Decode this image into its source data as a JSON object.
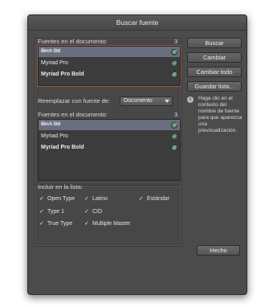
{
  "window": {
    "title": "Buscar fuente"
  },
  "doc_fonts": {
    "label": "Fuentes en el documento:",
    "count": "3",
    "items": [
      "Birch Std",
      "Myriad Pro",
      "Myriad Pro Bold"
    ]
  },
  "replace": {
    "label": "Reemplazar con fuente de:",
    "source": "Documento"
  },
  "replace_fonts": {
    "label": "Fuentes en el documento:",
    "count": "3",
    "items": [
      "Birch Std",
      "Myriad Pro",
      "Myriad Pro Bold"
    ]
  },
  "buttons": {
    "find": "Buscar",
    "change": "Cambiar",
    "change_all": "Cambiar todo",
    "save_list": "Guardar lista...",
    "done": "Hecho"
  },
  "info": {
    "text": "Haga clic en el contexto del nombre de fuente para que aparezca una previsualización."
  },
  "include": {
    "label": "Incluir en la lista:",
    "options": [
      "Open Type",
      "Latino",
      "Estándar",
      "Type 1",
      "CID",
      "True Type",
      "Multiple Master"
    ]
  },
  "icons": {
    "font_type": "opentype-icon",
    "info": "info-icon",
    "check": "check-icon",
    "dropdown": "chevron-down-icon"
  }
}
